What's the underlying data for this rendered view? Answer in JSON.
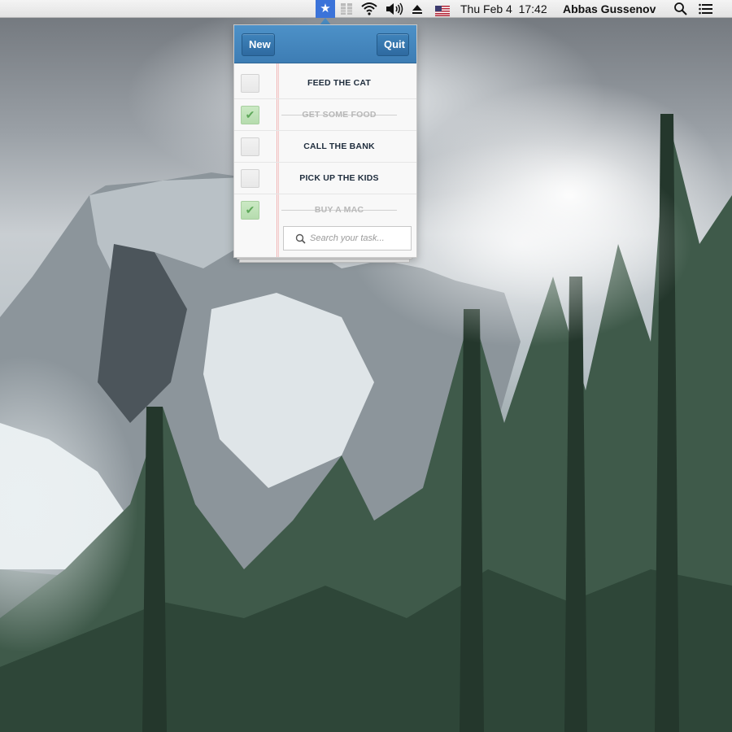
{
  "menubar": {
    "status_icon": "star-icon",
    "date_time": "Thu Feb 4  17:42",
    "user_name": "Abbas Gussenov",
    "icons": [
      "bars-icon",
      "wifi-icon",
      "volume-icon",
      "eject-icon",
      "us-flag-icon",
      "spotlight-search-icon",
      "notification-center-icon"
    ]
  },
  "popover": {
    "new_label": "New",
    "quit_label": "Quit",
    "tasks": [
      {
        "label": "FEED THE CAT",
        "done": false
      },
      {
        "label": "GET SOME FOOD",
        "done": true
      },
      {
        "label": "CALL THE BANK",
        "done": false
      },
      {
        "label": "PICK UP THE KIDS",
        "done": false
      },
      {
        "label": "BUY A MAC",
        "done": true
      }
    ],
    "search_placeholder": "Search your task..."
  },
  "colors": {
    "header_blue": "#4a8cc2",
    "menu_highlight": "#3b73d9",
    "done_green": "#b6dcae",
    "task_text": "#1f2d3d"
  }
}
